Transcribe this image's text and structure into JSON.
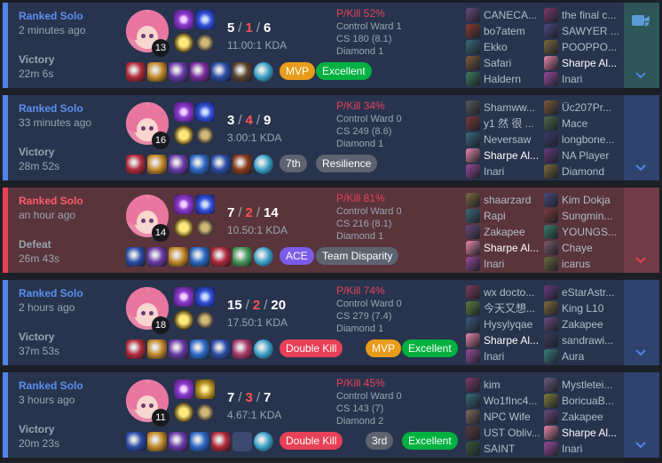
{
  "matches": [
    {
      "mode": "Ranked Solo",
      "ago": "2 minutes ago",
      "result": "Victory",
      "duration": "22m 6s",
      "outcome": "victory",
      "level": "13",
      "kda": {
        "k": "5",
        "d": "1",
        "a": "6",
        "ratio": "11.00:1 KDA"
      },
      "stats": {
        "pkill": "P/Kill 52%",
        "ward": "Control Ward 1",
        "cs": "CS 180 (8.1)",
        "rank": "Diamond 1"
      },
      "badges": [
        {
          "label": "MVP",
          "color": "#e89c1a"
        },
        {
          "label": "Excellent",
          "color": "#00b140"
        }
      ],
      "items": [
        "#b12a3c",
        "#c48a2a",
        "#6a3aa8",
        "#7b2ca0",
        "#2b4da8",
        "#5a4330",
        "#3aa0c8"
      ],
      "team1": [
        {
          "name": "CANECA...",
          "color": "#6b4b7e"
        },
        {
          "name": "bo7atem",
          "color": "#8a3b2b"
        },
        {
          "name": "Ekko",
          "color": "#3b6b7e"
        },
        {
          "name": "Safari",
          "color": "#7e5b3b"
        },
        {
          "name": "Haldern",
          "color": "#3b7e5b"
        }
      ],
      "team2": [
        {
          "name": "the final c...",
          "color": "#7e3b6b"
        },
        {
          "name": "SAWYER ...",
          "color": "#4b4b7e"
        },
        {
          "name": "POOPPO...",
          "color": "#7e6b3b"
        },
        {
          "name": "Sharpe Al...",
          "color": "#e887a9"
        },
        {
          "name": "Inari",
          "color": "#9a4b9a"
        }
      ],
      "me_team": 2,
      "me_index": 3,
      "video": true
    },
    {
      "mode": "Ranked Solo",
      "ago": "33 minutes ago",
      "result": "Victory",
      "duration": "28m 52s",
      "outcome": "victory",
      "level": "16",
      "kda": {
        "k": "3",
        "d": "4",
        "a": "9",
        "ratio": "3.00:1 KDA"
      },
      "stats": {
        "pkill": "P/Kill 34%",
        "ward": "Control Ward 0",
        "cs": "CS 249 (8.6)",
        "rank": "Diamond 1"
      },
      "badges": [
        {
          "label": "7th",
          "color": "#5d6470"
        },
        {
          "label": "Resilience",
          "color": "#5d6470"
        }
      ],
      "items": [
        "#b12a3c",
        "#c48a2a",
        "#6a3aa8",
        "#2b6ac8",
        "#2b4da8",
        "#8a3c1c",
        "#3aa0c8"
      ],
      "team1": [
        {
          "name": "Shamww...",
          "color": "#5b5b5b"
        },
        {
          "name": "y1 然 很 ...",
          "color": "#7e3b3b"
        },
        {
          "name": "Neversaw",
          "color": "#3b6b7e"
        },
        {
          "name": "Sharpe Al...",
          "color": "#e887a9"
        },
        {
          "name": "Inari",
          "color": "#9a4b9a"
        }
      ],
      "team2": [
        {
          "name": "Üc207Pr...",
          "color": "#7e5b3b"
        },
        {
          "name": "Mace",
          "color": "#4b6b4b"
        },
        {
          "name": "longbone...",
          "color": "#3b3b6b"
        },
        {
          "name": "NA Player",
          "color": "#6b3b7e"
        },
        {
          "name": "Diamond",
          "color": "#7e6b3b"
        }
      ],
      "me_team": 1,
      "me_index": 3,
      "video": false
    },
    {
      "mode": "Ranked Solo",
      "ago": "an hour ago",
      "result": "Defeat",
      "duration": "26m 43s",
      "outcome": "defeat",
      "level": "14",
      "kda": {
        "k": "7",
        "d": "2",
        "a": "14",
        "ratio": "10.50:1 KDA"
      },
      "stats": {
        "pkill": "P/Kill 81%",
        "ward": "Control Ward 0",
        "cs": "CS 216 (8.1)",
        "rank": "Diamond 1"
      },
      "badges": [
        {
          "label": "ACE",
          "color": "#7b5be8"
        },
        {
          "label": "Team Disparity",
          "color": "#5d6470"
        }
      ],
      "items": [
        "#2b4da8",
        "#6a3aa8",
        "#c48a2a",
        "#2b6ac8",
        "#b12a3c",
        "#4a9a5a",
        "#3aa0c8"
      ],
      "team1": [
        {
          "name": "shaarzard",
          "color": "#7e6b3b"
        },
        {
          "name": "Rapi",
          "color": "#3b6b7e"
        },
        {
          "name": "Zakapee",
          "color": "#6b4b7e"
        },
        {
          "name": "Sharpe Al...",
          "color": "#e887a9"
        },
        {
          "name": "Inari",
          "color": "#9a4b9a"
        }
      ],
      "team2": [
        {
          "name": "Kim Dokja",
          "color": "#4b4b7e"
        },
        {
          "name": "Sungmin...",
          "color": "#7e3b3b"
        },
        {
          "name": "YOUNGS...",
          "color": "#3b7e6b"
        },
        {
          "name": "Chaye",
          "color": "#7e5b6b"
        },
        {
          "name": "icarus",
          "color": "#6b6b3b"
        }
      ],
      "me_team": 1,
      "me_index": 3,
      "video": false
    },
    {
      "mode": "Ranked Solo",
      "ago": "2 hours ago",
      "result": "Victory",
      "duration": "37m 53s",
      "outcome": "victory",
      "level": "18",
      "kda": {
        "k": "15",
        "d": "2",
        "a": "20",
        "ratio": "17.50:1 KDA"
      },
      "stats": {
        "pkill": "P/Kill 74%",
        "ward": "Control Ward 0",
        "cs": "CS 279 (7.4)",
        "rank": "Diamond 1"
      },
      "badges": [
        {
          "label": "Double Kill",
          "color": "#e84057"
        },
        {
          "label": "MVP",
          "color": "#e89c1a"
        },
        {
          "label": "Excellent",
          "color": "#00b140"
        }
      ],
      "items": [
        "#b12a3c",
        "#c48a2a",
        "#6a3aa8",
        "#2b6ac8",
        "#2b4da8",
        "#a83a6a",
        "#3aa0c8"
      ],
      "team1": [
        {
          "name": "wx docto...",
          "color": "#7e3b5b"
        },
        {
          "name": "今天又想...",
          "color": "#5b7e3b"
        },
        {
          "name": "Hysylyqae",
          "color": "#3b5b7e"
        },
        {
          "name": "Sharpe Al...",
          "color": "#e887a9"
        },
        {
          "name": "Inari",
          "color": "#9a4b9a"
        }
      ],
      "team2": [
        {
          "name": "eStarAstr...",
          "color": "#6b3b7e"
        },
        {
          "name": "King L10",
          "color": "#7e6b3b"
        },
        {
          "name": "Zakapee",
          "color": "#6b4b7e"
        },
        {
          "name": "sandrawi...",
          "color": "#3b3b5b"
        },
        {
          "name": "Aura",
          "color": "#3b7e7e"
        }
      ],
      "me_team": 1,
      "me_index": 3,
      "video": false
    },
    {
      "mode": "Ranked Solo",
      "ago": "3 hours ago",
      "result": "Victory",
      "duration": "20m 23s",
      "outcome": "victory",
      "level": "11",
      "kda": {
        "k": "7",
        "d": "3",
        "a": "7",
        "ratio": "4.67:1 KDA"
      },
      "stats": {
        "pkill": "P/Kill 45%",
        "ward": "Control Ward 0",
        "cs": "CS 143 (7)",
        "rank": "Diamond 2"
      },
      "badges": [
        {
          "label": "Double Kill",
          "color": "#e84057"
        },
        {
          "label": "3rd",
          "color": "#5d6470"
        },
        {
          "label": "Excellent",
          "color": "#00b140"
        }
      ],
      "items": [
        "#2b4da8",
        "#c48a2a",
        "#6a3aa8",
        "#2b6ac8",
        "#b12a3c",
        "",
        "#3aa0c8"
      ],
      "team1": [
        {
          "name": "kim",
          "color": "#7e3b6b"
        },
        {
          "name": "Wo1fInc4...",
          "color": "#3b6b7e"
        },
        {
          "name": "NPC Wife",
          "color": "#7e6b5b"
        },
        {
          "name": "UST Obliv...",
          "color": "#5b3b3b"
        },
        {
          "name": "SAINT",
          "color": "#3b5b3b"
        }
      ],
      "team2": [
        {
          "name": "Mystletei...",
          "color": "#6b5b7e"
        },
        {
          "name": "BoricuaB...",
          "color": "#7e7e3b"
        },
        {
          "name": "Zakapee",
          "color": "#6b4b7e"
        },
        {
          "name": "Sharpe Al...",
          "color": "#e887a9"
        },
        {
          "name": "Inari",
          "color": "#9a4b9a"
        }
      ],
      "me_team": 2,
      "me_index": 3,
      "video": false
    }
  ]
}
